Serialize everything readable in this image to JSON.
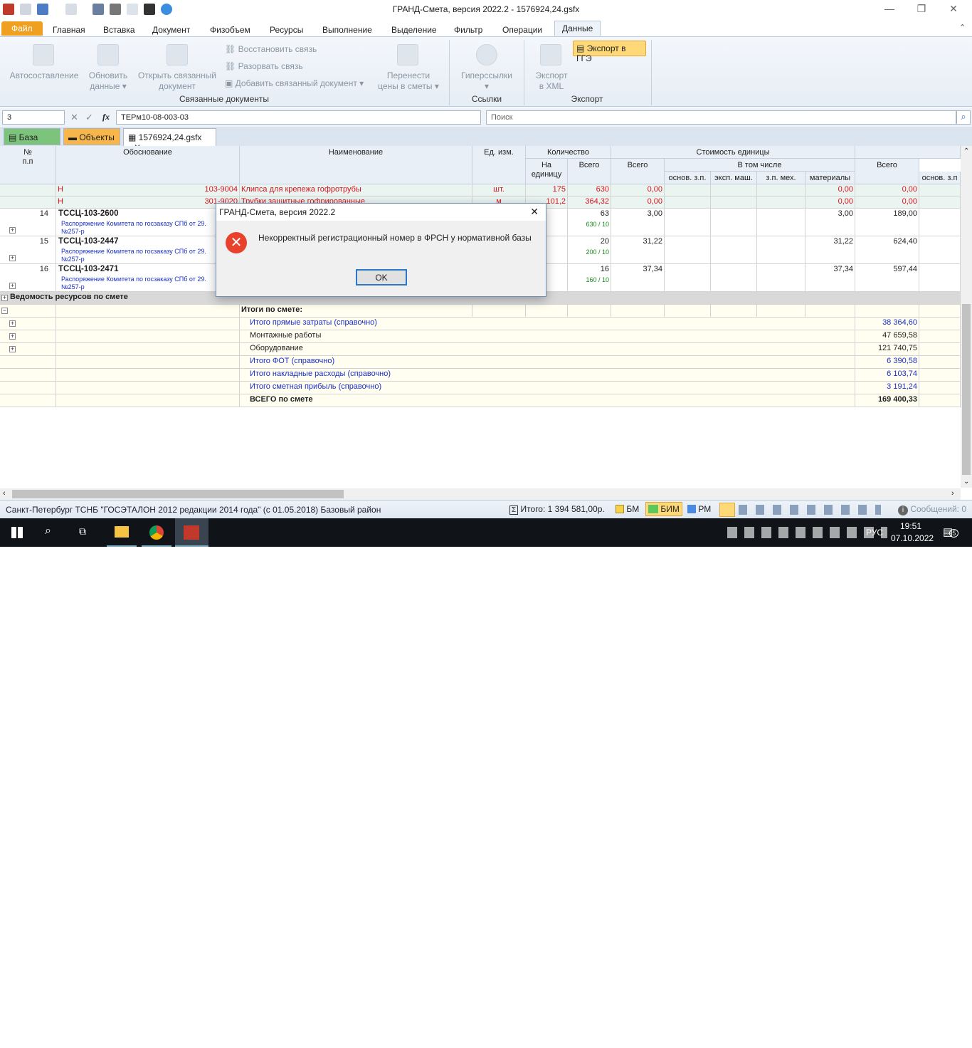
{
  "window": {
    "title": "ГРАНД-Смета, версия 2022.2 - 1576924,24.gsfx",
    "minimize": "—",
    "maximize": "❐",
    "close": "✕"
  },
  "tabs": [
    "Файл",
    "Главная",
    "Вставка",
    "Документ",
    "Физобъем",
    "Ресурсы",
    "Выполнение",
    "Выделение",
    "Фильтр",
    "Операции",
    "Данные"
  ],
  "ribbon": {
    "autosostavlenie": "Автосоставление",
    "obnovit": [
      "Обновить",
      "данные ▾"
    ],
    "otkryt": [
      "Открыть связанный",
      "документ"
    ],
    "restore": "Восстановить связь",
    "break": "Разорвать связь",
    "add": "Добавить связанный документ ▾",
    "perenesti": [
      "Перенести",
      "цены в сметы ▾"
    ],
    "group_linked": "Связанные документы",
    "hyper": [
      "Гиперссылки",
      "▾"
    ],
    "group_links": "Ссылки",
    "xml": [
      "Экспорт",
      "в XML"
    ],
    "gge": "Экспорт в ГГЭ",
    "group_export": "Экспорт"
  },
  "formula": {
    "cell": "3",
    "value": "ТЕРм10-08-003-03",
    "search_placeholder": "Поиск",
    "fx": "fx"
  },
  "doctabs": {
    "base": "База",
    "objects": "Объекты",
    "file": "1576924,24.gsfx",
    "close": "✕"
  },
  "headers": {
    "num": "№\nп.п",
    "obosn": "Обоснование",
    "name": "Наименование",
    "unit": "Ед. изм.",
    "qty": "Количество",
    "qty_unit": "На\nединицу",
    "qty_total": "Всего",
    "cost_unit": "Стоимость единицы",
    "cost_total": "Всего",
    "incl": "В том числе",
    "zp": "основ. з.п.",
    "mash": "эксп. маш.",
    "zpmex": "з.п. мех.",
    "mat": "материалы",
    "total": "Всего",
    "total_zp": "основ. з.п"
  },
  "res_rows": [
    {
      "mark": "Н",
      "code": "103-9004",
      "name": "Клипса для крепежа гофротрубы",
      "unit": "шт.",
      "per": "175",
      "qty": "630",
      "cost": "0,00",
      "mat": "0,00",
      "total": "0,00"
    },
    {
      "mark": "Н",
      "code": "301-9020",
      "name": "Трубки защитные гофрированные",
      "unit": "м",
      "per": "101,2",
      "qty": "364,32",
      "cost": "0,00",
      "mat": "0,00",
      "total": "0,00"
    }
  ],
  "rows": [
    {
      "num": "14",
      "code": "ТССЦ-103-2600",
      "doc": "Распоряжение Комитета по госзаказу СПб от 29.",
      "doc2": "№257-р",
      "qty": "63",
      "formula": "630 / 10",
      "cost": "3,00",
      "mat": "3,00",
      "total": "189,00"
    },
    {
      "num": "15",
      "code": "ТССЦ-103-2447",
      "doc": "Распоряжение Комитета по госзаказу СПб от 29.",
      "doc2": "№257-р",
      "qty": "20",
      "formula": "200 / 10",
      "cost": "31,22",
      "mat": "31,22",
      "total": "624,40"
    },
    {
      "num": "16",
      "code": "ТССЦ-103-2471",
      "doc": "Распоряжение Комитета по госзаказу СПб от 29.",
      "doc2": "№257-р",
      "qty": "16",
      "formula": "160 / 10",
      "cost": "37,34",
      "mat": "37,34",
      "total": "597,44"
    }
  ],
  "vedomost": "Ведомость ресурсов по смете",
  "itogi_title": "Итоги по смете:",
  "totals": [
    {
      "label": "Итого прямые затраты (справочно)",
      "value": "38 364,60",
      "blue": true,
      "plus": true
    },
    {
      "label": "Монтажные работы",
      "value": "47 659,58",
      "blue": false,
      "plus": true
    },
    {
      "label": "Оборудование",
      "value": "121 740,75",
      "blue": false,
      "plus": true
    },
    {
      "label": "Итого ФОТ (справочно)",
      "value": "6 390,58",
      "blue": true,
      "plus": false
    },
    {
      "label": "Итого накладные расходы (справочно)",
      "value": "6 103,74",
      "blue": true,
      "plus": false
    },
    {
      "label": "Итого сметная прибыль (справочно)",
      "value": "3 191,24",
      "blue": true,
      "plus": false
    },
    {
      "label": "ВСЕГО по смете",
      "value": "169 400,33",
      "blue": false,
      "plus": false,
      "bold": true
    }
  ],
  "dialog": {
    "title": "ГРАНД-Смета, версия 2022.2",
    "message": "Некорректный регистрационный номер в ФРСН у нормативной базы",
    "ok": "OK",
    "close": "✕"
  },
  "status": {
    "region": "Санкт-Петербург ТСНБ \"ГОСЭТАЛОН 2012 редакции 2014 года\" (с 01.05.2018)   Базовый район",
    "itogo": "Итого: 1 394 581,00р.",
    "bm": "БМ",
    "bim": "БИМ",
    "rm": "РМ",
    "messages": "Сообщений: 0"
  },
  "taskbar": {
    "lang": "РУС",
    "time": "19:51",
    "date": "07.10.2022",
    "notif": "5"
  },
  "colors": {
    "accent": "#f0a020",
    "error": "#e8412c",
    "link": "#1a2fc4",
    "resource": "#d8141c"
  }
}
